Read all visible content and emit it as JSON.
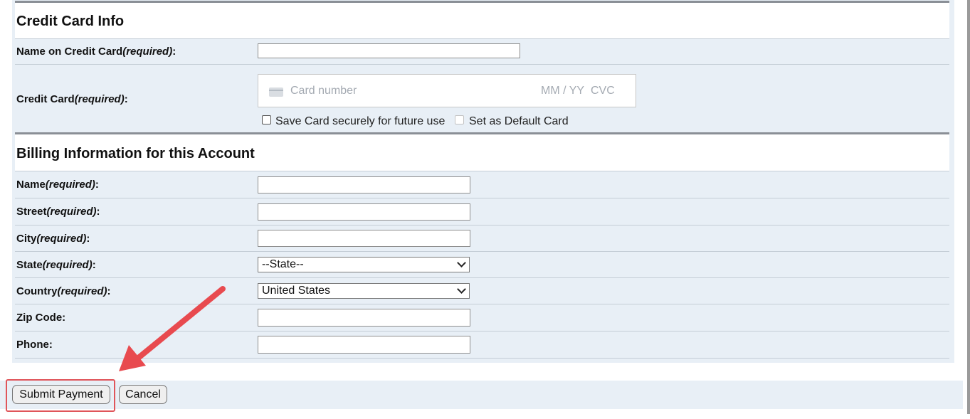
{
  "credit_section": {
    "title": "Credit Card Info",
    "name_on_card": {
      "label": "Name on Credit Card",
      "required": "(required)",
      "colon": ":",
      "value": ""
    },
    "credit_card": {
      "label": "Credit Card",
      "required": "(required)",
      "colon": ":",
      "number_placeholder": "Card number",
      "expiry_placeholder": "MM / YY",
      "cvc_placeholder": "CVC"
    },
    "save_card_label": "Save Card securely for future use",
    "default_card_label": "Set as Default Card"
  },
  "billing_section": {
    "title": "Billing Information for this Account",
    "name": {
      "label": "Name",
      "required": "(required)",
      "colon": ":",
      "value": ""
    },
    "street": {
      "label": "Street",
      "required": "(required)",
      "colon": ":",
      "value": ""
    },
    "city": {
      "label": "City",
      "required": "(required)",
      "colon": ":",
      "value": ""
    },
    "state": {
      "label": "State",
      "required": "(required)",
      "colon": ":",
      "selected": "--State--"
    },
    "country": {
      "label": "Country",
      "required": "(required)",
      "colon": ":",
      "selected": "United States"
    },
    "zip": {
      "label": "Zip Code:",
      "value": ""
    },
    "phone": {
      "label": "Phone:",
      "value": ""
    }
  },
  "actions": {
    "submit_label": "Submit Payment",
    "cancel_label": "Cancel"
  },
  "colors": {
    "panel_bg": "#e8eff6",
    "annotation_red": "#e0555a"
  },
  "icons": [
    "credit-card-icon",
    "chevron-down-icon",
    "annotation-arrow-icon"
  ]
}
